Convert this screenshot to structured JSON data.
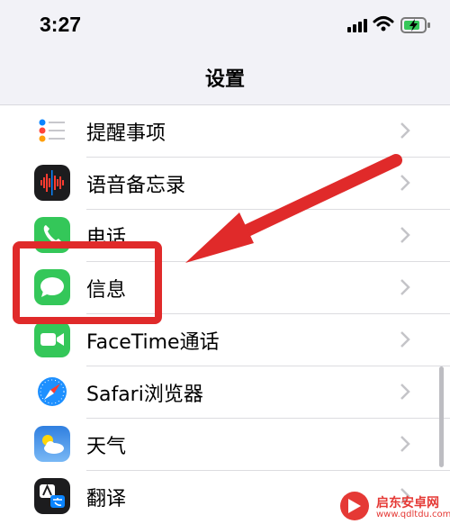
{
  "status_bar": {
    "time": "3:27"
  },
  "nav": {
    "title": "设置"
  },
  "rows": [
    {
      "label": "提醒事项",
      "icon": "reminders-icon"
    },
    {
      "label": "语音备忘录",
      "icon": "voice-memos-icon"
    },
    {
      "label": "电话",
      "icon": "phone-icon"
    },
    {
      "label": "信息",
      "icon": "messages-icon"
    },
    {
      "label": "FaceTime通话",
      "icon": "facetime-icon"
    },
    {
      "label": "Safari浏览器",
      "icon": "safari-icon"
    },
    {
      "label": "天气",
      "icon": "weather-icon"
    },
    {
      "label": "翻译",
      "icon": "translate-icon"
    }
  ],
  "watermark": {
    "text": "启东安卓网",
    "url": "www.qdltdu.com"
  },
  "colors": {
    "annotation_red": "#e02a2a",
    "background": "#efeff4"
  }
}
